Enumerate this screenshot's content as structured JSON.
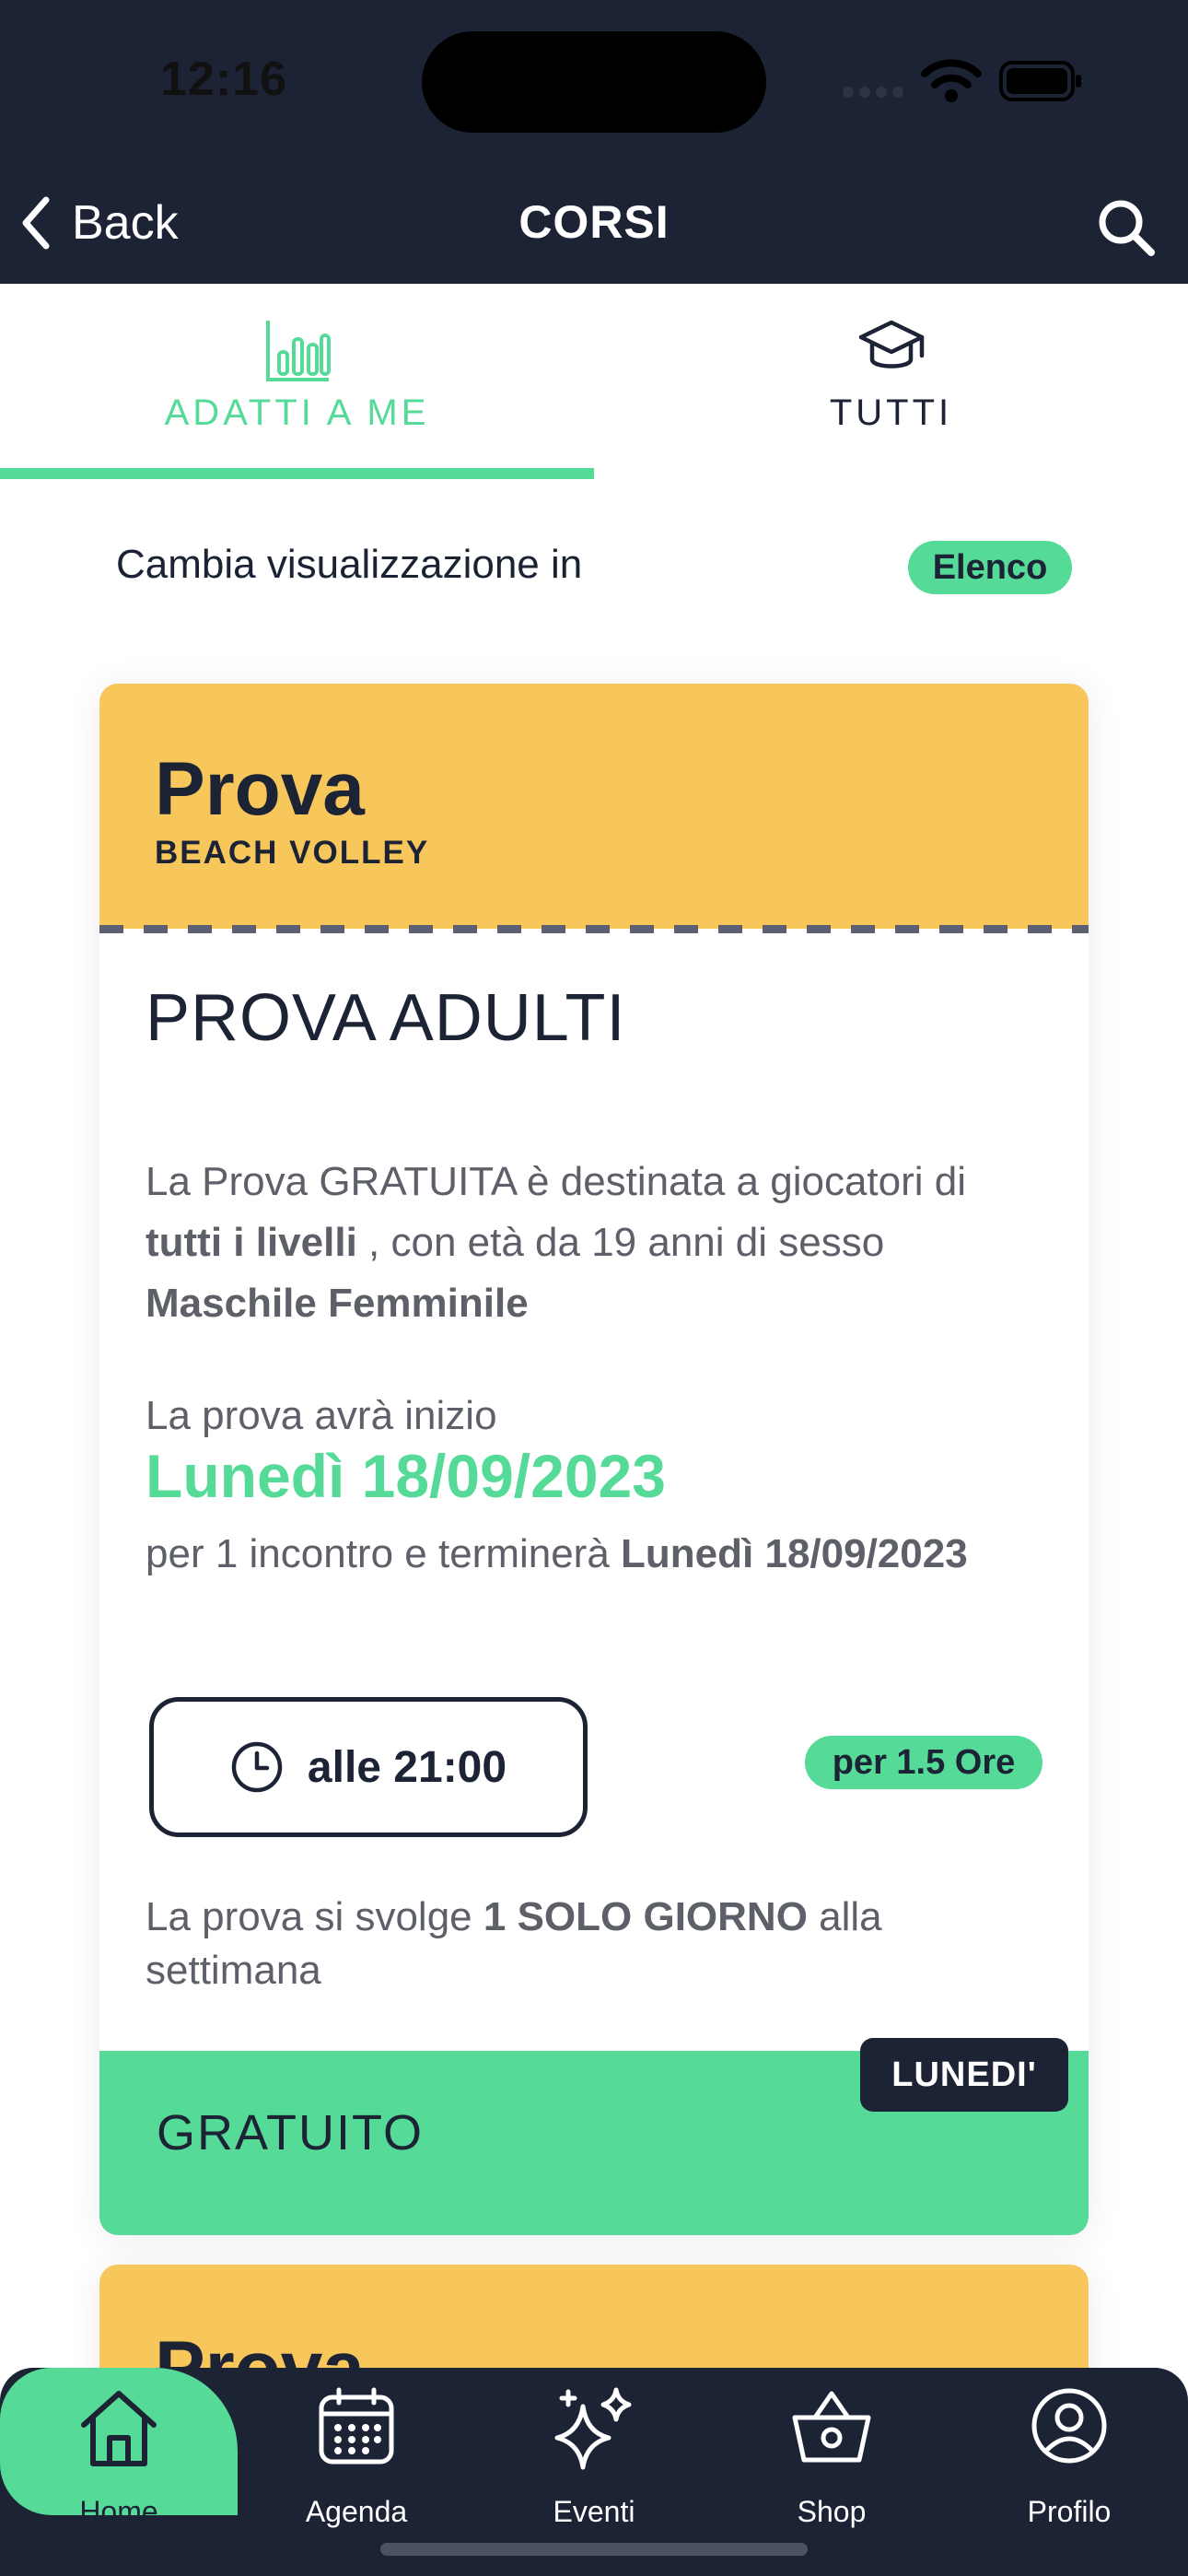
{
  "status_bar": {
    "time": "12:16"
  },
  "header": {
    "back_label": "Back",
    "title": "CORSI"
  },
  "tabs": [
    {
      "label": "ADATTI A ME",
      "icon": "bar-chart-icon",
      "active": true
    },
    {
      "label": "TUTTI",
      "icon": "graduation-cap-icon",
      "active": false
    }
  ],
  "view_toggle": {
    "label": "Cambia visualizzazione in",
    "value": "Elenco"
  },
  "courses": [
    {
      "type": "Prova",
      "sport": "BEACH VOLLEY",
      "name": "PROVA ADULTI",
      "description": {
        "p1": "La Prova GRATUITA è destinata a giocatori di ",
        "levels": "tutti i livelli",
        "p2": " , con età da 19 anni di sesso ",
        "gender": "Maschile Femminile"
      },
      "start_label": "La prova avrà inizio",
      "start_date": "Lunedì 18/09/2023",
      "duration": {
        "p1": " per 1 incontro e terminerà ",
        "end": "Lunedì 18/09/2023"
      },
      "time": "alle 21:00",
      "hours": "per 1.5 Ore",
      "frequency": {
        "p1": "La prova si svolge ",
        "bold": "1 SOLO GIORNO",
        "p2": " alla settimana"
      },
      "price": "GRATUITO",
      "day": "LUNEDI'"
    },
    {
      "type": "Prova"
    }
  ],
  "bottom_nav": [
    {
      "label": "Home",
      "icon": "home-icon",
      "active": true
    },
    {
      "label": "Agenda",
      "icon": "calendar-icon",
      "active": false
    },
    {
      "label": "Eventi",
      "icon": "sparkles-icon",
      "active": false
    },
    {
      "label": "Shop",
      "icon": "basket-icon",
      "active": false
    },
    {
      "label": "Profilo",
      "icon": "user-circle-icon",
      "active": false
    }
  ],
  "colors": {
    "navy": "#1b2335",
    "green": "#55da98",
    "yellow": "#f7c75c"
  }
}
